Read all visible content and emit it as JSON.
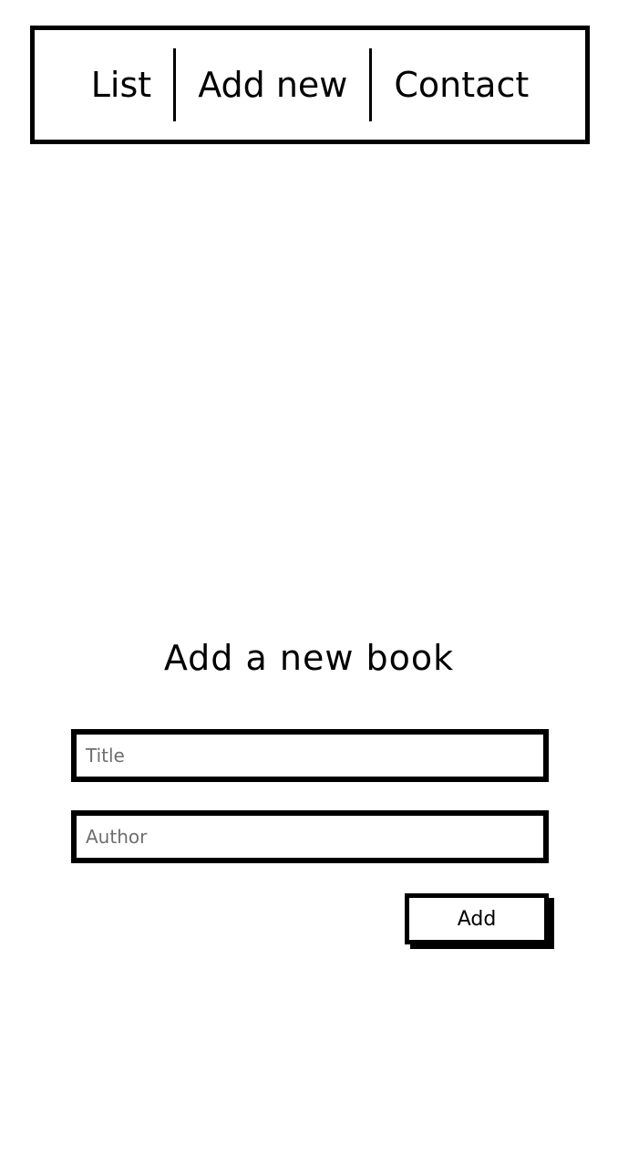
{
  "nav": {
    "items": [
      {
        "label": "List"
      },
      {
        "label": "Add new"
      },
      {
        "label": "Contact"
      }
    ]
  },
  "form": {
    "heading": "Add a new book",
    "title_field": {
      "placeholder": "Title",
      "value": ""
    },
    "author_field": {
      "placeholder": "Author",
      "value": ""
    },
    "submit_label": "Add"
  }
}
